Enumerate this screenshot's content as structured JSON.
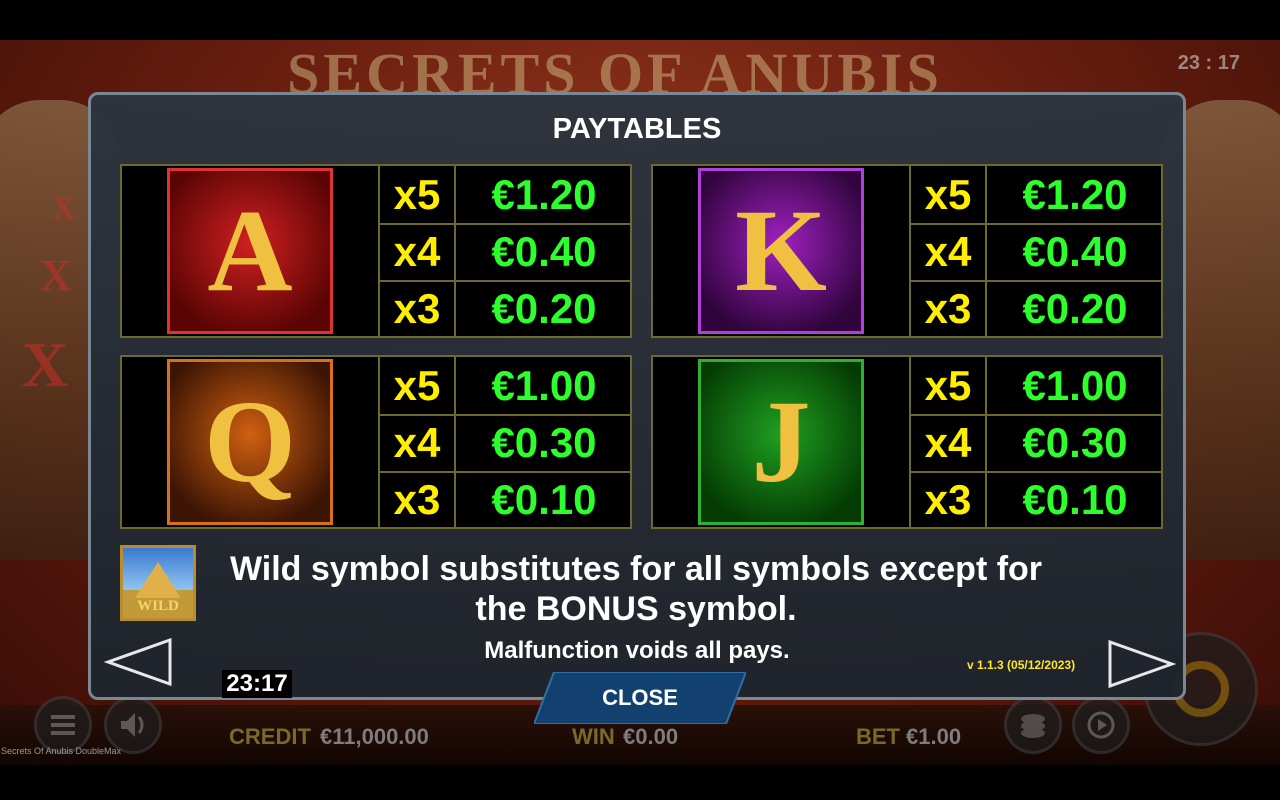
{
  "background": {
    "logo_text": "SECRETS OF ANUBIS",
    "clock": "23 : 17"
  },
  "bottom_bar": {
    "credit_label": "CREDIT",
    "credit_value": "€11,000.00",
    "win_label": "WIN",
    "win_value": "€0.00",
    "bet_label": "BET",
    "bet_value": "€1.00",
    "game_title": "Secrets Of Anubis DoubleMax"
  },
  "paytable": {
    "title": "PAYTABLES",
    "tables": [
      {
        "symbol": "A",
        "rows": [
          {
            "mult": "x5",
            "pay": "€1.20"
          },
          {
            "mult": "x4",
            "pay": "€0.40"
          },
          {
            "mult": "x3",
            "pay": "€0.20"
          }
        ]
      },
      {
        "symbol": "K",
        "rows": [
          {
            "mult": "x5",
            "pay": "€1.20"
          },
          {
            "mult": "x4",
            "pay": "€0.40"
          },
          {
            "mult": "x3",
            "pay": "€0.20"
          }
        ]
      },
      {
        "symbol": "Q",
        "rows": [
          {
            "mult": "x5",
            "pay": "€1.00"
          },
          {
            "mult": "x4",
            "pay": "€0.30"
          },
          {
            "mult": "x3",
            "pay": "€0.10"
          }
        ]
      },
      {
        "symbol": "J",
        "rows": [
          {
            "mult": "x5",
            "pay": "€1.00"
          },
          {
            "mult": "x4",
            "pay": "€0.30"
          },
          {
            "mult": "x3",
            "pay": "€0.10"
          }
        ]
      }
    ],
    "wild_icon_label": "WILD",
    "wild_text": "Wild symbol substitutes for all symbols except for the BONUS symbol.",
    "malfunction": "Malfunction voids all pays.",
    "version": "v 1.1.3 (05/12/2023)",
    "clock": "23:17",
    "close_label": "CLOSE"
  },
  "colors": {
    "multiplier": "#ffee00",
    "payout": "#2cff2c",
    "version": "#ffe82a",
    "A_tile": "#b81414",
    "K_tile": "#8a1ab0",
    "Q_tile": "#c4580a",
    "J_tile": "#1d8a1d"
  },
  "icons": [
    "arrow-left-icon",
    "arrow-right-icon",
    "menu-icon",
    "sound-icon",
    "coins-icon",
    "autoplay-icon",
    "spin-icon"
  ]
}
